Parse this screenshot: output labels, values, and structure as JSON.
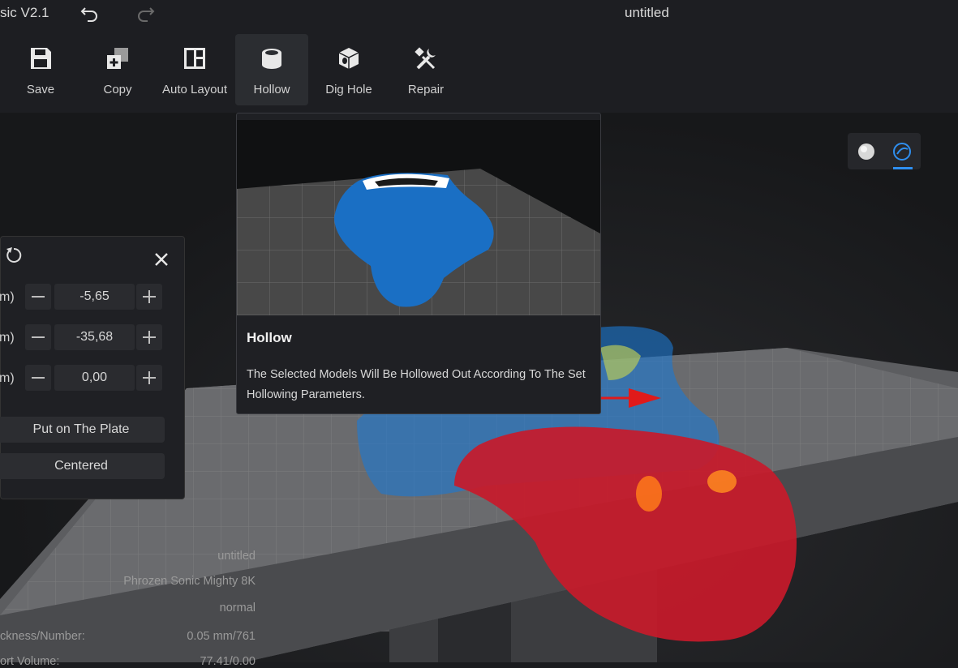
{
  "app": {
    "title": "sic V2.1",
    "document_title": "untitled"
  },
  "toolbar": {
    "items": [
      {
        "label": "Save",
        "icon": "save-icon"
      },
      {
        "label": "Copy",
        "icon": "copy-icon"
      },
      {
        "label": "Auto Layout",
        "icon": "auto-layout-icon"
      },
      {
        "label": "Hollow",
        "icon": "hollow-icon",
        "active": true
      },
      {
        "label": "Dig Hole",
        "icon": "dig-hole-icon"
      },
      {
        "label": "Repair",
        "icon": "repair-icon"
      }
    ]
  },
  "tooltip": {
    "title": "Hollow",
    "description": "The Selected Models Will Be Hollowed Out According To The Set Hollowing Parameters."
  },
  "move_panel": {
    "rows": [
      {
        "label": "m)",
        "value": "-5,65"
      },
      {
        "label": "m)",
        "value": "-35,68"
      },
      {
        "label": "m)",
        "value": "0,00"
      }
    ],
    "put_on_plate": "Put on The Plate",
    "centered": "Centered"
  },
  "info": {
    "name": "untitled",
    "printer": "Phrozen Sonic Mighty 8K",
    "profile": "normal",
    "thickness_label": "ckness/Number:",
    "thickness_value": "0.05 mm/761",
    "volume_label": "ort Volume:",
    "volume_value": "77.41/0.00"
  },
  "colors": {
    "accent": "#2f8ff0",
    "model_blue": "#1a6fc4",
    "model_red": "#c81a2a"
  }
}
